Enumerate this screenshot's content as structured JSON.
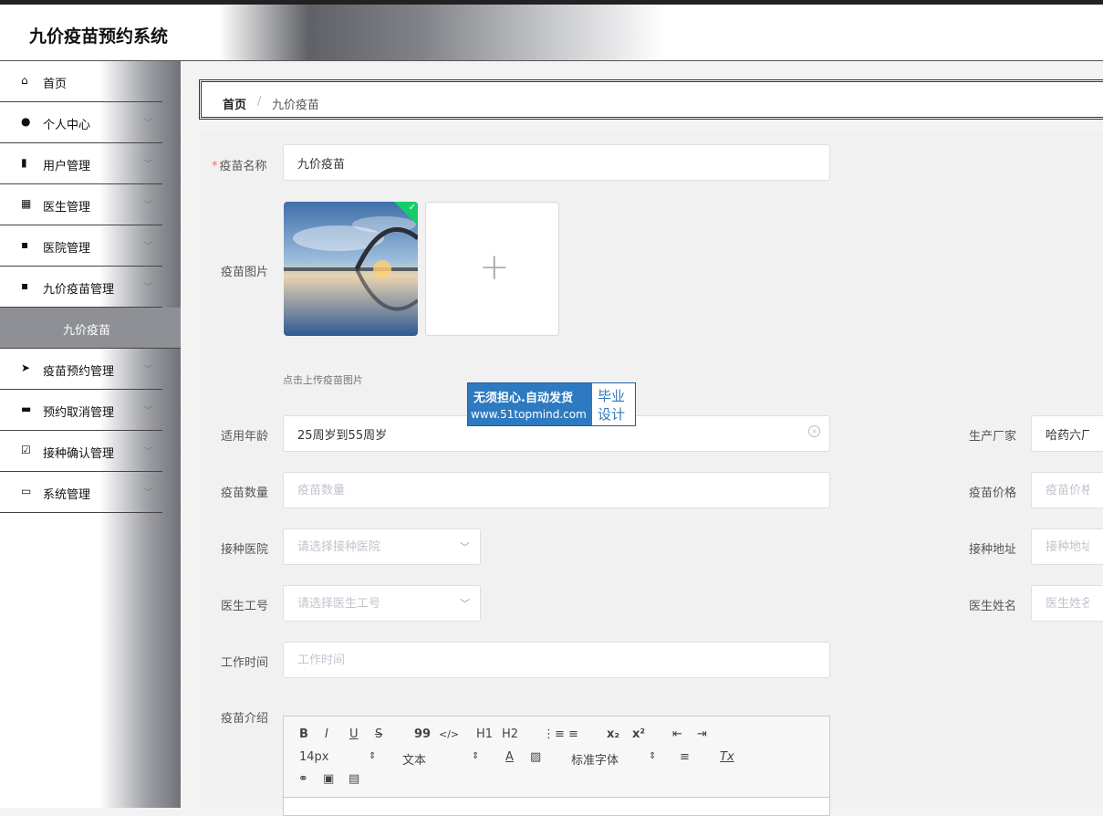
{
  "app": {
    "title": "九价疫苗预约系统"
  },
  "sidebar": {
    "items": [
      {
        "label": "首页",
        "icon": "home-icon",
        "glyph": "⌂",
        "expandable": false
      },
      {
        "label": "个人中心",
        "icon": "user-icon",
        "glyph": "●",
        "expandable": true
      },
      {
        "label": "用户管理",
        "icon": "book-icon",
        "glyph": "▮",
        "expandable": true
      },
      {
        "label": "医生管理",
        "icon": "grid-icon",
        "glyph": "▦",
        "expandable": true
      },
      {
        "label": "医院管理",
        "icon": "apps-icon",
        "glyph": "▪",
        "expandable": true
      },
      {
        "label": "九价疫苗管理",
        "icon": "apps-icon",
        "glyph": "▪",
        "expandable": true
      },
      {
        "label": "九价疫苗",
        "submenu": true
      },
      {
        "label": "疫苗预约管理",
        "icon": "send-icon",
        "glyph": "➤",
        "expandable": true
      },
      {
        "label": "预约取消管理",
        "icon": "briefcase-icon",
        "glyph": "▬",
        "expandable": true
      },
      {
        "label": "接种确认管理",
        "icon": "check-square-icon",
        "glyph": "☑",
        "expandable": true
      },
      {
        "label": "系统管理",
        "icon": "message-icon",
        "glyph": "▭",
        "expandable": true
      }
    ]
  },
  "breadcrumb": {
    "home": "首页",
    "separator": "/",
    "current": "九价疫苗"
  },
  "form": {
    "vaccine_name": {
      "label": "疫苗名称",
      "value": "九价疫苗",
      "required": true
    },
    "vaccine_image": {
      "label": "疫苗图片",
      "hint": "点击上传疫苗图片",
      "add_symbol": "+",
      "uploaded_mark": "✓"
    },
    "age": {
      "label": "适用年龄",
      "value": "25周岁到55周岁",
      "clear_symbol": "×"
    },
    "manufacturer": {
      "label": "生产厂家",
      "value": "哈药六厂"
    },
    "quantity": {
      "label": "疫苗数量",
      "placeholder": "疫苗数量"
    },
    "price": {
      "label": "疫苗价格",
      "placeholder": "疫苗价格"
    },
    "hospital": {
      "label": "接种医院",
      "placeholder": "请选择接种医院"
    },
    "address": {
      "label": "接种地址",
      "placeholder": "接种地址"
    },
    "doctor_id": {
      "label": "医生工号",
      "placeholder": "请选择医生工号"
    },
    "doctor_name": {
      "label": "医生姓名",
      "placeholder": "医生姓名"
    },
    "work_time": {
      "label": "工作时间",
      "placeholder": "工作时间"
    },
    "intro": {
      "label": "疫苗介绍"
    }
  },
  "editor": {
    "bold": "B",
    "italic": "I",
    "underline": "U",
    "strike": "S",
    "quote": "99",
    "code": "</>",
    "h1": "H1",
    "h2": "H2",
    "ordered_list": "⋮≡",
    "bullet_list": "≡",
    "subscript": "x₂",
    "superscript": "x²",
    "outdent": "⇤",
    "indent": "⇥",
    "size": "14px",
    "paragraph": "文本",
    "font": "标准字体",
    "caret": "⇕",
    "color": "A",
    "background": "▨",
    "align": "≡",
    "clean": "Tx",
    "link": "⚭",
    "image": "▣",
    "video": "▤"
  },
  "watermark": {
    "line1": "无须担心.自动发货",
    "line2": "www.51topmind.com",
    "badge1": "毕业",
    "badge2": "设计"
  }
}
